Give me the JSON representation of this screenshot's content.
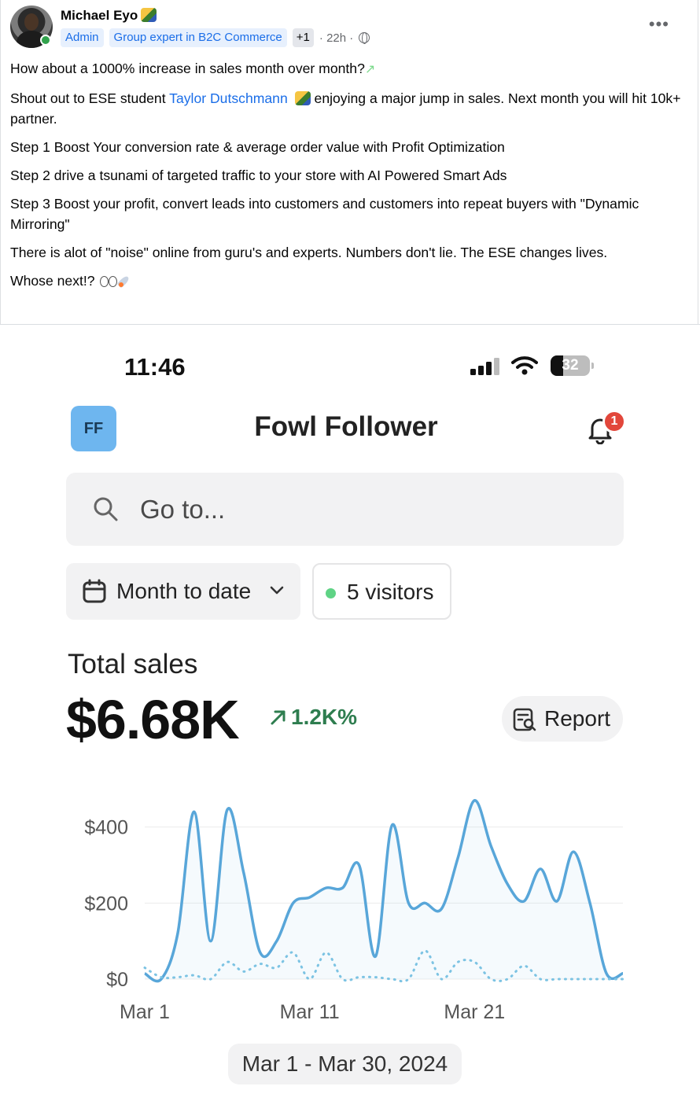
{
  "post": {
    "author": "Michael Eyo",
    "badges": [
      "Admin",
      "Group expert in B2C Commerce"
    ],
    "more_badges": "+1",
    "time": "22h",
    "separator": "·",
    "more_menu": "•••",
    "paragraphs": [
      "How about a 1000% increase in sales month over month?",
      "Shout out to ESE student",
      "Step 1 Boost Your conversion rate & average order value with Profit Optimization",
      "Step 2 drive a tsunami of targeted traffic to your store with AI Powered Smart Ads",
      "Step 3 Boost your profit, convert leads into customers and customers into repeat buyers with \"Dynamic Mirroring\"",
      "There is alot of \"noise\" online from guru's and experts. Numbers don't lie. The ESE changes lives.",
      "Whose next!?"
    ],
    "mention": "Taylor Dutschmann",
    "shoutout_tail": "enjoying a major jump in sales. Next month you will hit 10k+ partner."
  },
  "phone": {
    "status_time": "11:46",
    "battery": "32",
    "store_initials": "FF",
    "store_name": "Fowl Follower",
    "notification_count": "1",
    "search_placeholder": "Go to...",
    "date_filter": "Month to date",
    "visitors": "5 visitors",
    "sales_label": "Total sales",
    "sales_value": "$6.68K",
    "growth": "1.2K%",
    "report_label": "Report",
    "date_range": "Mar 1 - Mar 30, 2024",
    "colors": {
      "accent_line": "#58a6d9",
      "growth_green": "#2e7d4f",
      "badge_red": "#e2473b",
      "online_green": "#5fd385"
    }
  },
  "chart_data": {
    "type": "line",
    "x": [
      1,
      2,
      3,
      4,
      5,
      6,
      7,
      8,
      9,
      10,
      11,
      12,
      13,
      14,
      15,
      16,
      17,
      18,
      19,
      20,
      21,
      22,
      23,
      24,
      25,
      26,
      27,
      28,
      29,
      30
    ],
    "x_ticks": [
      "Mar 1",
      "Mar 11",
      "Mar 21"
    ],
    "x_tick_values": [
      1,
      11,
      21
    ],
    "y_ticks": [
      "$0",
      "$200",
      "$400"
    ],
    "y_tick_values": [
      0,
      200,
      400
    ],
    "ylim": [
      0,
      480
    ],
    "grid": true,
    "series": [
      {
        "style": "solid",
        "values": [
          15,
          0,
          120,
          440,
          100,
          445,
          280,
          70,
          100,
          200,
          215,
          240,
          240,
          300,
          60,
          405,
          200,
          200,
          185,
          320,
          470,
          350,
          250,
          205,
          290,
          205,
          335,
          200,
          15,
          15
        ]
      },
      {
        "style": "dotted",
        "values": [
          30,
          5,
          5,
          10,
          0,
          45,
          20,
          40,
          30,
          70,
          0,
          70,
          0,
          5,
          5,
          0,
          0,
          75,
          0,
          45,
          45,
          0,
          0,
          35,
          0,
          0,
          0,
          0,
          0,
          0
        ]
      }
    ]
  }
}
